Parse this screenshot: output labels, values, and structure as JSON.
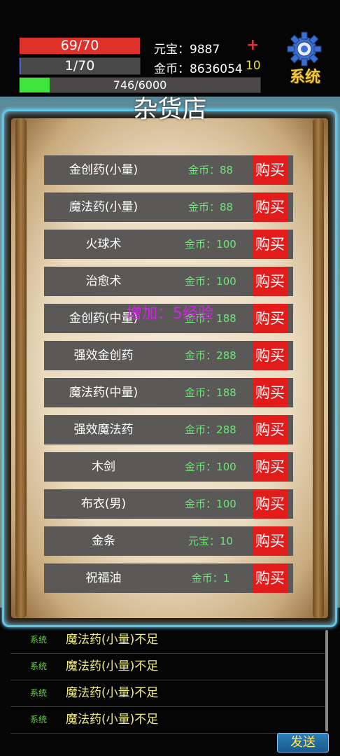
{
  "status": {
    "hp_text": "69/70",
    "mp_text": "1/70",
    "exp_text": "746/6000",
    "exp_fraction": 0.124,
    "yuanbao_label": "元宝：9887",
    "gold_label": "金币：8636054",
    "plus_symbol": "+",
    "gold_extra": "10",
    "system_button_label": "系统"
  },
  "shop": {
    "title": "杂货店",
    "floating_message": "增加：5经验",
    "buy_label": "购买",
    "items": [
      {
        "name": "金创药(小量)",
        "price": "金币：88"
      },
      {
        "name": "魔法药(小量)",
        "price": "金币：88"
      },
      {
        "name": "火球术",
        "price": "金币：100"
      },
      {
        "name": "治愈术",
        "price": "金币：100"
      },
      {
        "name": "金创药(中量)",
        "price": "金币：188"
      },
      {
        "name": "强效金创药",
        "price": "金币：288"
      },
      {
        "name": "魔法药(中量)",
        "price": "金币：188"
      },
      {
        "name": "强效魔法药",
        "price": "金币：288"
      },
      {
        "name": "木剑",
        "price": "金币：100"
      },
      {
        "name": "布衣(男)",
        "price": "金币：100"
      },
      {
        "name": "金条",
        "price": "元宝：10"
      },
      {
        "name": "祝福油",
        "price": "金币：1"
      }
    ]
  },
  "chat": {
    "rows": [
      {
        "tag": "系统",
        "msg": "魔法药(小量)不足"
      },
      {
        "tag": "系统",
        "msg": "魔法药(小量)不足"
      },
      {
        "tag": "系统",
        "msg": "魔法药(小量)不足"
      },
      {
        "tag": "系统",
        "msg": "魔法药(小量)不足"
      }
    ],
    "send_label": "发送"
  },
  "colors": {
    "hp": "#e0302a",
    "exp": "#3fe43a",
    "buy": "#e21b1b",
    "price": "#6fe47a",
    "panel_border": "#5fc6e8"
  }
}
